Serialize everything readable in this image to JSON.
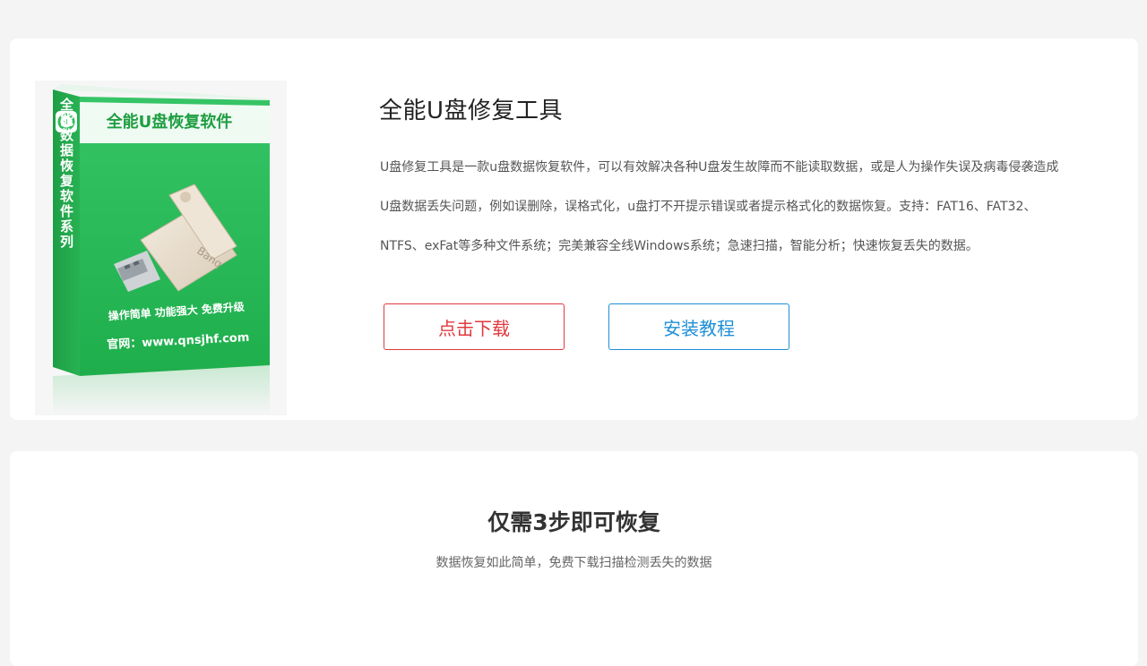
{
  "product": {
    "box": {
      "box_title": "全能U盘恢复软件",
      "side_text": "全能数据恢复软件系列",
      "slogan": "操作简单 功能强大 免费升级",
      "website": "官网：www.qnsjhf.com",
      "usb_brand": "Banq",
      "brand_color": "#2ebd58"
    },
    "title": "全能U盘修复工具",
    "description_lines": [
      "U盘修复工具是一款u盘数据恢复软件，可以有效解决各种U盘发生故障而不能读取数据，或是人为操作失误及病毒侵袭造成",
      "U盘数据丢失问题，例如误删除，误格式化，u盘打不开提示错误或者提示格式化的数据恢复。支持：FAT16、FAT32、",
      "NTFS、exFat等多种文件系统；完美兼容全线Windows系统；急速扫描，智能分析；快速恢复丢失的数据。"
    ],
    "download_button": "点击下载",
    "tutorial_button": "安装教程",
    "colors": {
      "download": "#e0393e",
      "tutorial": "#1e8fd6"
    }
  },
  "steps": {
    "title": "仅需3步即可恢复",
    "subtitle": "数据恢复如此简单，免费下载扫描检测丢失的数据"
  }
}
